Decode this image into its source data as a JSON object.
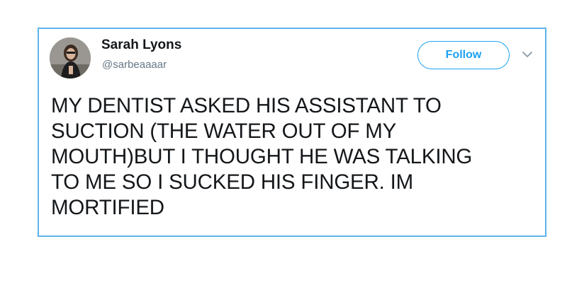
{
  "author": {
    "name": "Sarah Lyons",
    "handle": "@sarbeaaaar"
  },
  "follow_button": {
    "label": "Follow"
  },
  "tweet": {
    "lines": [
      "MY DENTIST ASKED HIS ASSISTANT TO",
      "SUCTION (THE WATER OUT OF MY",
      "MOUTH)BUT I THOUGHT HE WAS TALKING",
      "TO ME SO I SUCKED HIS FINGER. IM",
      "MORTIFIED"
    ]
  },
  "colors": {
    "accent": "#1da1f2",
    "card_border": "#5fb3ea",
    "text": "#14171a",
    "muted": "#657786"
  },
  "icons": {
    "avatar": "avatar",
    "menu": "chevron-down-icon"
  }
}
